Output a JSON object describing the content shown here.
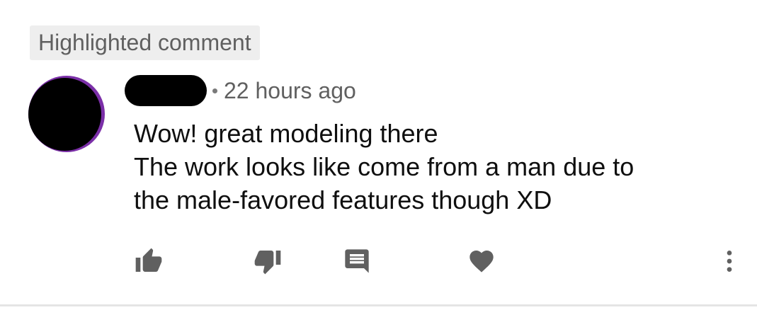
{
  "badge": {
    "label": "Highlighted comment"
  },
  "comment": {
    "timestamp": "22 hours ago",
    "lines": [
      "Wow! great modeling there",
      "The work looks like come from a man due to",
      "the male-favored features though XD"
    ]
  },
  "actions": {
    "icons": [
      "thumbs-up-icon",
      "thumbs-down-icon",
      "reply-icon",
      "heart-icon",
      "more-vert-icon"
    ]
  },
  "colors": {
    "avatar_ring": "#7b2fa8",
    "icon": "#606060",
    "text": "#0f0f0f",
    "secondary_text": "#606060"
  }
}
